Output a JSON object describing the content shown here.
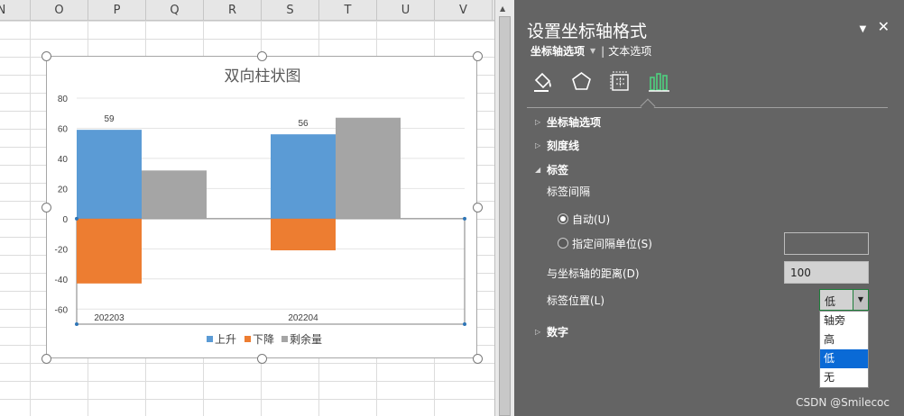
{
  "spreadsheet": {
    "columns": [
      "N",
      "O",
      "P",
      "Q",
      "R",
      "S",
      "T",
      "U",
      "V"
    ]
  },
  "chart": {
    "title": "双向柱状图",
    "legend": [
      "上升",
      "下降",
      "剩余量"
    ],
    "series_colors": [
      "#5b9bd5",
      "#ed7d31",
      "#a5a5a5"
    ]
  },
  "chart_data": {
    "type": "bar",
    "title": "双向柱状图",
    "categories": [
      "202203",
      "202204"
    ],
    "series": [
      {
        "name": "上升",
        "values": [
          59,
          56
        ]
      },
      {
        "name": "下降",
        "values": [
          -43,
          -21
        ]
      },
      {
        "name": "剩余量",
        "values": [
          32,
          67
        ]
      }
    ],
    "data_labels": [
      {
        "series": "上升",
        "category": "202203",
        "text": "59"
      },
      {
        "series": "上升",
        "category": "202204",
        "text": "56"
      }
    ],
    "ylim": [
      -70,
      80
    ],
    "yticks": [
      80,
      60,
      40,
      20,
      0,
      -20,
      -40,
      -60
    ],
    "grid": true,
    "legend_position": "bottom"
  },
  "pane": {
    "title": "设置坐标轴格式",
    "tab_axis_options": "坐标轴选项",
    "tab_text_options": "文本选项",
    "icons": [
      "fill-line-icon",
      "effects-icon",
      "size-properties-icon",
      "axis-options-icon"
    ],
    "sections": {
      "axis_options": "坐标轴选项",
      "tick_marks": "刻度线",
      "labels": "标签",
      "number": "数字"
    },
    "label_interval": "标签间隔",
    "auto": "自动(U)",
    "specify_interval": "指定间隔单位(S)",
    "distance_from_axis": "与坐标轴的距离(D)",
    "distance_value": "100",
    "label_position": "标签位置(L)",
    "label_position_value": "低",
    "dropdown_options": [
      "轴旁",
      "高",
      "低",
      "无"
    ],
    "dropdown_selected": "低"
  },
  "watermark": "CSDN @Smilecoc"
}
